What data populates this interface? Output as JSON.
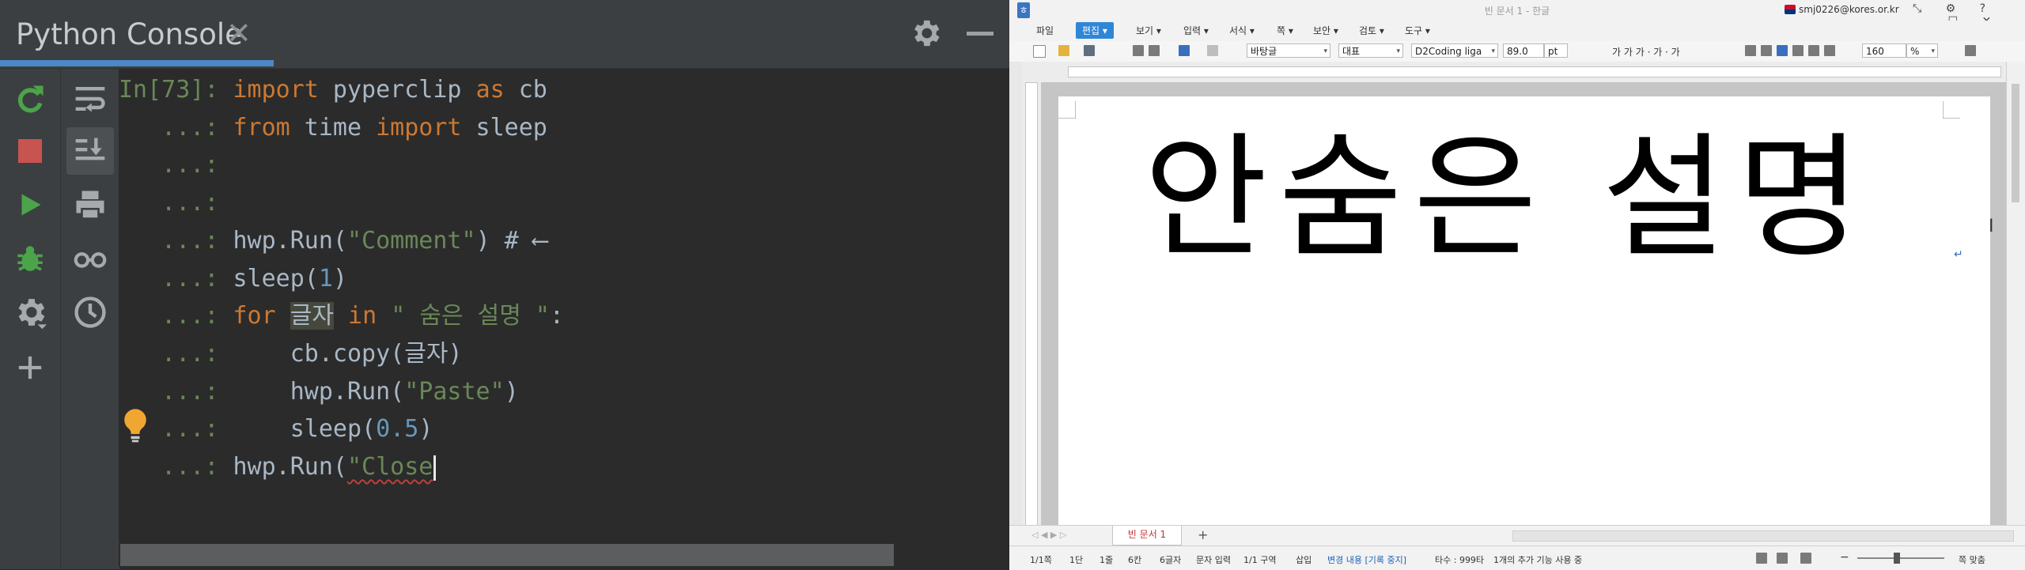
{
  "console": {
    "tab_title": "Python Console",
    "tab_close": "✕",
    "lines": [
      {
        "prompt": "In[73]:",
        "tokens": [
          {
            "t": "import",
            "c": "kw"
          },
          {
            "t": " pyperclip ",
            "c": "plain"
          },
          {
            "t": "as",
            "c": "kw"
          },
          {
            "t": " cb",
            "c": "plain"
          }
        ]
      },
      {
        "prompt": "   ...:",
        "tokens": [
          {
            "t": "from",
            "c": "kw"
          },
          {
            "t": " time ",
            "c": "plain"
          },
          {
            "t": "import",
            "c": "kw"
          },
          {
            "t": " sleep",
            "c": "plain"
          }
        ]
      },
      {
        "prompt": "   ...:",
        "tokens": []
      },
      {
        "prompt": "   ...:",
        "tokens": []
      },
      {
        "prompt": "   ...:",
        "tokens": [
          {
            "t": "hwp.Run(",
            "c": "plain"
          },
          {
            "t": "\"Comment\"",
            "c": "str"
          },
          {
            "t": ") # ⟵",
            "c": "plain"
          }
        ]
      },
      {
        "prompt": "   ...:",
        "tokens": [
          {
            "t": "sleep(",
            "c": "plain"
          },
          {
            "t": "1",
            "c": "num"
          },
          {
            "t": ")",
            "c": "plain"
          }
        ]
      },
      {
        "prompt": "   ...:",
        "tokens": [
          {
            "t": "for",
            "c": "kw"
          },
          {
            "t": " ",
            "c": "plain"
          },
          {
            "t": "글자",
            "c": "hl-var"
          },
          {
            "t": " ",
            "c": "plain"
          },
          {
            "t": "in",
            "c": "kw"
          },
          {
            "t": " ",
            "c": "plain"
          },
          {
            "t": "\" 숨은 설명 \"",
            "c": "str"
          },
          {
            "t": ":",
            "c": "plain"
          }
        ]
      },
      {
        "prompt": "   ...:",
        "tokens": [
          {
            "t": "    cb.copy(글자)",
            "c": "plain"
          }
        ]
      },
      {
        "prompt": "   ...:",
        "tokens": [
          {
            "t": "    hwp.Run(",
            "c": "plain"
          },
          {
            "t": "\"Paste\"",
            "c": "str"
          },
          {
            "t": ")",
            "c": "plain"
          }
        ]
      },
      {
        "prompt": "   ...:",
        "tokens": [
          {
            "t": "    sleep(",
            "c": "plain"
          },
          {
            "t": "0.5",
            "c": "num"
          },
          {
            "t": ")",
            "c": "plain"
          }
        ]
      },
      {
        "prompt": "   ...:",
        "tokens": [
          {
            "t": "hwp.Run(",
            "c": "plain"
          },
          {
            "t": "\"Close",
            "c": "str squiggle"
          }
        ],
        "caret": true
      }
    ]
  },
  "hwp": {
    "title": "빈 문서 1 - 한글",
    "user": "smj0226@kores.or.kr",
    "window_controls": "⤡ ⚙ ? — ☐ ✕",
    "menus": {
      "file": "파일",
      "edit": "편집 ▾",
      "view": "보기 ▾",
      "input": "입력 ▾",
      "format": "서식 ▾",
      "page": "쪽 ▾",
      "security": "보안 ▾",
      "review": "검토 ▾",
      "tools": "도구 ▾"
    },
    "toolbar": {
      "style": "바탕글",
      "font_group": "대표",
      "font": "D2Coding liga",
      "font_size": "89.0",
      "unit": "pt",
      "format_buttons": "가  가  가  ·  가  ·  가",
      "zoom": "160",
      "zoom_unit": "%"
    },
    "document_text": "안숨은 설명",
    "paragraph_mark": "↵",
    "ibeam": "I",
    "doc_tab": "빈 문서 1",
    "add_tab": "+",
    "status": {
      "page": "1/1쪽",
      "column": "1단",
      "line": "1줄",
      "char_col": "6칸",
      "char_count": "6글자",
      "input_mode": "문자 입력",
      "section": "1/1 구역",
      "insert": "삽입",
      "change": "변경 내용 [기록 중지]",
      "typing": "타수 : 999타",
      "feature": "1개의 추가 기능 사용 중",
      "fit": "쪽 맞춤"
    }
  }
}
